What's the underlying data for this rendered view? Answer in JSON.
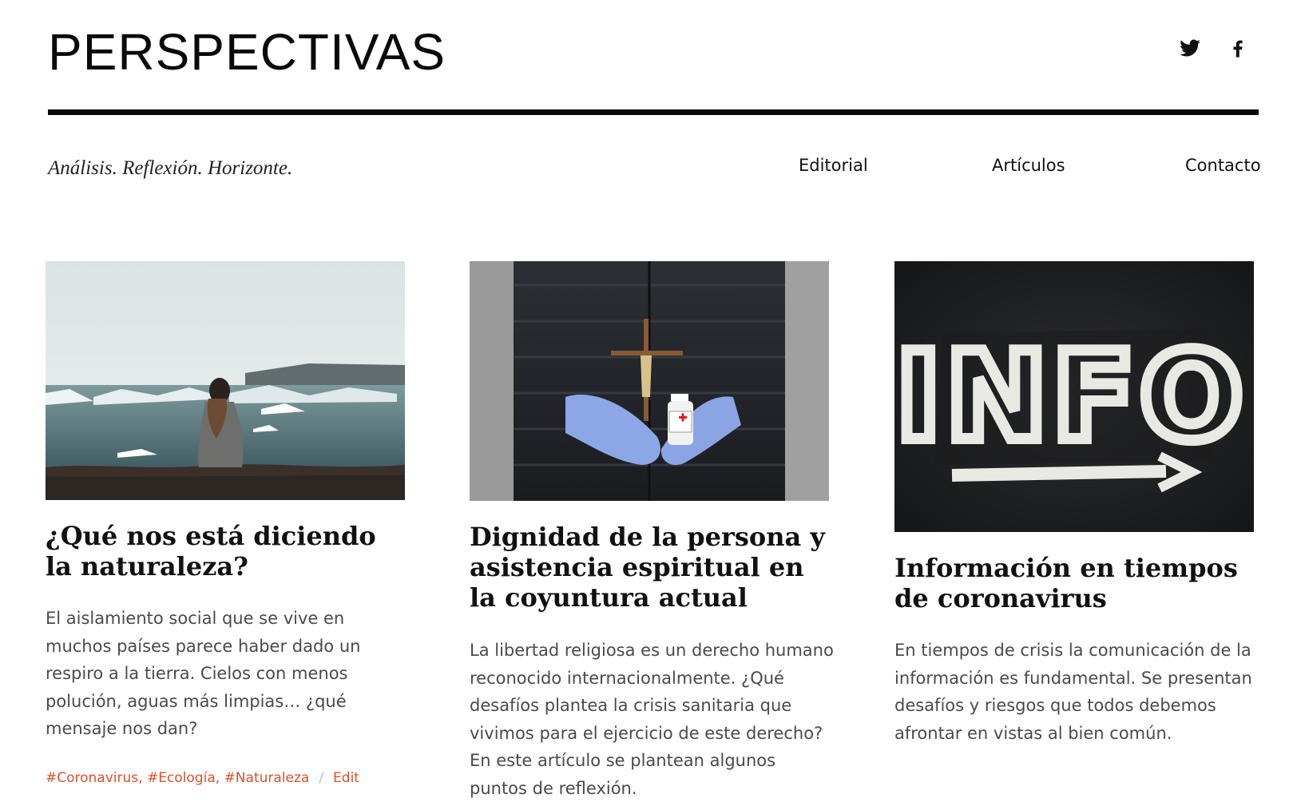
{
  "site": {
    "title": "PERSPECTIVAS",
    "tagline": "Análisis. Reflexión. Horizonte."
  },
  "social": [
    {
      "name": "Twitter",
      "icon": "twitter-icon"
    },
    {
      "name": "Facebook",
      "icon": "facebook-icon"
    }
  ],
  "nav": [
    "Editorial",
    "Artículos",
    "Contacto"
  ],
  "colors": {
    "accent": "#d8522a",
    "text": "#111111",
    "excerpt": "#4a4a4a"
  },
  "posts": [
    {
      "title": "¿Qué nos está diciendo la naturaleza?",
      "excerpt": "El aislamiento social que se vive en muchos países parece haber dado un respiro a la tierra. Cielos con menos polución, aguas más limpias… ¿qué mensaje nos dan?",
      "tags": [
        "#Coronavirus",
        "#Ecología",
        "#Naturaleza"
      ],
      "edit": "Edit"
    },
    {
      "title": "Dignidad de la persona y asistencia espiritual en la coyuntura actual",
      "excerpt": "La libertad religiosa es un derecho humano reconocido internacionalmente. ¿Qué desafíos plantea la crisis sanitaria que vivimos para el ejercicio de este derecho? En este artículo se plantean algunos puntos de reflexión."
    },
    {
      "title": "Información en tiempos de coronavirus",
      "excerpt": "En tiempos de crisis la comunicación de la información es fundamental. Se presentan desafíos y riesgos que todos debemos afrontar en vistas al bien común.",
      "image_text": "INFO"
    }
  ]
}
